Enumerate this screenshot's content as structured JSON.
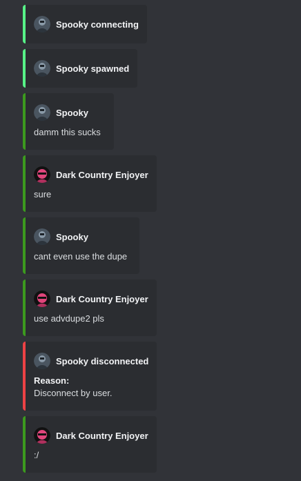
{
  "messages": [
    {
      "author": "Spooky connecting",
      "avatar": "spooky-avatar",
      "accent": "#57f287"
    },
    {
      "author": "Spooky spawned",
      "avatar": "spooky-avatar",
      "accent": "#57f287"
    },
    {
      "author": "Spooky",
      "avatar": "spooky-avatar",
      "text": "damm this sucks",
      "accent": "#3c9a1e"
    },
    {
      "author": "Dark Country Enjoyer",
      "avatar": "enjoyer-avatar",
      "text": "sure",
      "accent": "#3c9a1e"
    },
    {
      "author": "Spooky",
      "avatar": "spooky-avatar",
      "text": "cant even use the dupe",
      "accent": "#3c9a1e"
    },
    {
      "author": "Dark Country Enjoyer",
      "avatar": "enjoyer-avatar",
      "text": "use advdupe2 pls",
      "accent": "#3c9a1e"
    },
    {
      "author": "Spooky disconnected",
      "avatar": "spooky-avatar",
      "reason_label": "Reason:",
      "reason": "Disconnect by user.",
      "accent": "#ed4245"
    },
    {
      "author": "Dark Country Enjoyer",
      "avatar": "enjoyer-avatar",
      "text": ":/",
      "accent": "#3c9a1e"
    }
  ]
}
